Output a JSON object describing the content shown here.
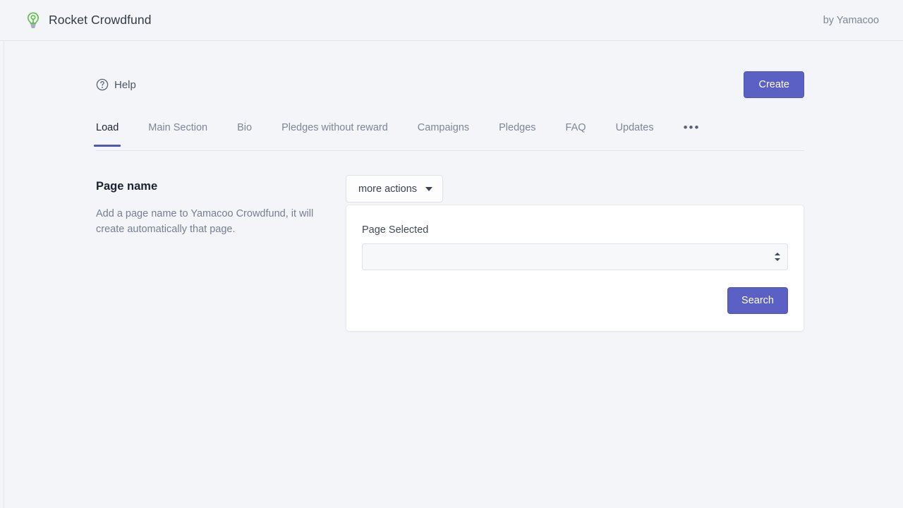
{
  "header": {
    "logo_icon": "lightbulb-icon",
    "logo_color": "#56c040",
    "title": "Rocket Crowdfund",
    "byline": "by Yamacoo"
  },
  "toolbar": {
    "help_icon": "question-mark-circle-icon",
    "help_label": "Help",
    "create_label": "Create",
    "accent_color": "#5b61c4"
  },
  "tabs": {
    "active_index": 0,
    "overflow_icon": "ellipsis-horizontal-icon",
    "overflow_label": "•••",
    "items": [
      {
        "label": "Load"
      },
      {
        "label": "Main Section"
      },
      {
        "label": "Bio"
      },
      {
        "label": "Pledges without reward"
      },
      {
        "label": "Campaigns"
      },
      {
        "label": "Pledges"
      },
      {
        "label": "FAQ"
      },
      {
        "label": "Updates"
      }
    ]
  },
  "section": {
    "title": "Page name",
    "description": "Add a page name to Yamacoo Crowdfund, it will create automatically that page."
  },
  "panel": {
    "more_actions_label": "more actions",
    "more_actions_caret_icon": "chevron-down-icon",
    "field_label": "Page Selected",
    "select_value": "",
    "select_placeholder": "",
    "select_stepper_icon": "stepper-up-down-icon",
    "select_options": [
      ""
    ],
    "search_label": "Search"
  }
}
